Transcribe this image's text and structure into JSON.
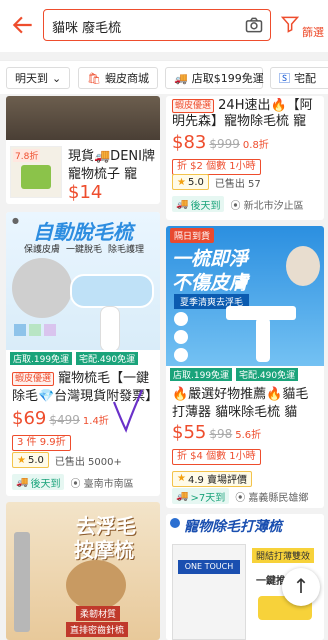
{
  "search": {
    "query": "貓咪 廢毛梳"
  },
  "header": {
    "filter_label": "篩選"
  },
  "filters": [
    {
      "label": "明天到"
    },
    {
      "label": "蝦皮商城"
    },
    {
      "label": "店取$199免運"
    },
    {
      "label": "宅配"
    }
  ],
  "colors": {
    "accent": "#ee4d2d",
    "ship": "#1aa37a"
  },
  "products": {
    "p1": {
      "title": "現貨🚚DENI牌 寵物梳子 寵物...",
      "price": "$14",
      "sale_tag": "7.8折"
    },
    "p2": {
      "badge": "蝦皮優選",
      "title": "24H速出🔥【阿明先森】寵物除毛梳 寵物...",
      "price": "$83",
      "old_price": "$999",
      "discount": "0.8折",
      "coupon": "折 $2 個數 1小時",
      "rating": "5.0",
      "sold": "已售出 57",
      "ship": "後天到",
      "loc": "新北市汐止區"
    },
    "p3": {
      "img_title": "自動脫毛梳",
      "img_sub1": "保護皮膚",
      "img_sub2": "一鍵脫毛",
      "img_sub3": "除毛護理",
      "img_ship1": "店取.199免運",
      "img_ship2": "宅配.490免運",
      "badge": "蝦皮優選",
      "title": "寵物梳毛【一鍵除毛💎台灣現貨附發票】",
      "price": "$69",
      "old_price": "$499",
      "discount": "1.4折",
      "promo": "3 件 9.9折",
      "rating": "5.0",
      "sold": "已售出 5000+",
      "ship": "後天到",
      "loc": "臺南市南區"
    },
    "p4": {
      "img_top": "隔日到貨",
      "img_title1": "一梳即淨",
      "img_title2": "不傷皮膚",
      "img_banner": "夏季清爽去浮毛",
      "img_ship1": "店取.199免運",
      "img_ship2": "宅配.490免運",
      "title": "🔥嚴選好物推薦🔥貓毛打薄器 貓咪除毛梳 貓咪...",
      "price": "$55",
      "old_price": "$98",
      "discount": "5.6折",
      "coupon": "折 $4 個數 1小時",
      "rating": "4.9 賣場評價",
      "ship": ">7天到",
      "loc": "嘉義縣民雄鄉"
    },
    "p5": {
      "img_title1": "去浮毛",
      "img_title2": "按摩梳",
      "img_sub1": "柔韌材質",
      "img_sub2": "直排密齒針梳"
    },
    "p6": {
      "img_title": "寵物除毛打薄梳",
      "img_sub": "開結打薄雙效",
      "img_brand": "ONE TOUCH",
      "img_tag": "一鍵推"
    }
  }
}
